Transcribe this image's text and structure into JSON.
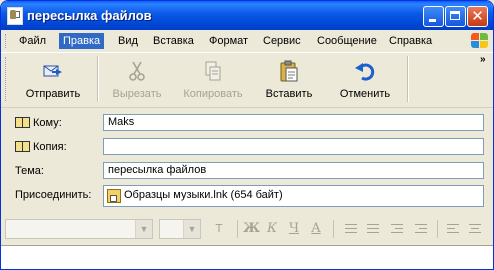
{
  "window": {
    "title": "пересылка файлов"
  },
  "menu": {
    "items": [
      {
        "label": "Файл"
      },
      {
        "label": "Правка",
        "active": true
      },
      {
        "label": "Вид"
      },
      {
        "label": "Вставка"
      },
      {
        "label": "Формат"
      },
      {
        "label": "Сервис"
      },
      {
        "label": "Сообщение"
      },
      {
        "label": "Справка"
      }
    ]
  },
  "toolbar": {
    "send": {
      "label": "Отправить",
      "icon": "send-mail-icon",
      "enabled": true
    },
    "cut": {
      "label": "Вырезать",
      "icon": "scissors-icon",
      "enabled": false
    },
    "copy": {
      "label": "Копировать",
      "icon": "copy-icon",
      "enabled": false
    },
    "paste": {
      "label": "Вставить",
      "icon": "clipboard-icon",
      "enabled": true
    },
    "undo": {
      "label": "Отменить",
      "icon": "undo-arrow-icon",
      "enabled": true
    }
  },
  "fields": {
    "to": {
      "label": "Кому:",
      "value": "Maks"
    },
    "cc": {
      "label": "Копия:",
      "value": ""
    },
    "subject": {
      "label": "Тема:",
      "value": "пересылка файлов"
    },
    "attach": {
      "label": "Присоединить:",
      "value": "Образцы музыки.lnk (654 байт)"
    }
  },
  "format": {
    "bold": "Ж",
    "italic": "К",
    "underline": "Ч",
    "font_color": "A"
  },
  "colors": {
    "title_bar": "#0a58e6",
    "menu_highlight": "#316ac5",
    "disabled_text": "#a7a391",
    "undo_blue": "#1c5fcf"
  }
}
